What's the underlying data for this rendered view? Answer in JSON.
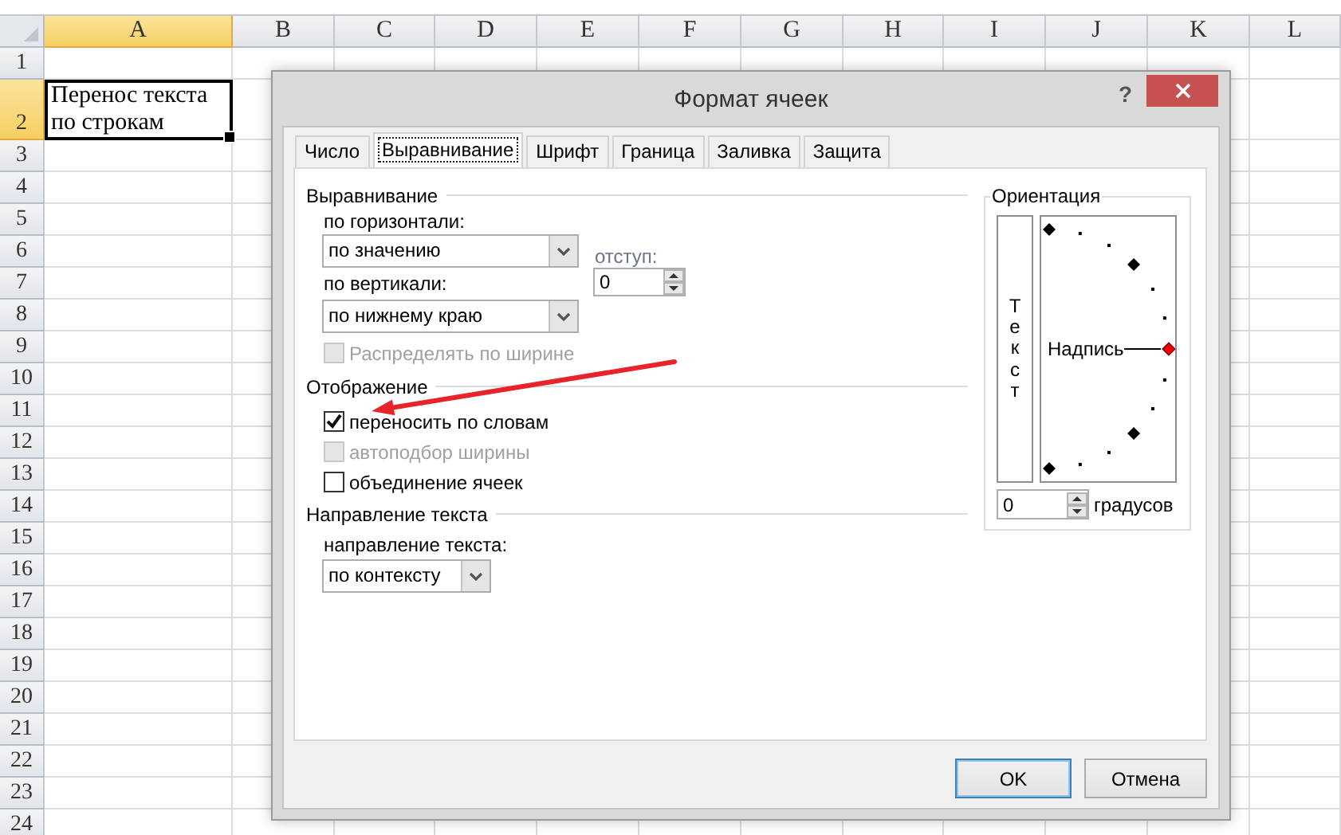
{
  "spreadsheet": {
    "columns": [
      {
        "label": "A",
        "selected": true
      },
      {
        "label": "B",
        "selected": false
      },
      {
        "label": "C",
        "selected": false
      },
      {
        "label": "D",
        "selected": false
      },
      {
        "label": "E",
        "selected": false
      },
      {
        "label": "F",
        "selected": false
      },
      {
        "label": "G",
        "selected": false
      },
      {
        "label": "H",
        "selected": false
      },
      {
        "label": "I",
        "selected": false
      },
      {
        "label": "J",
        "selected": false
      },
      {
        "label": "K",
        "selected": false
      },
      {
        "label": "L",
        "selected": false
      }
    ],
    "rows": [
      {
        "label": "1",
        "selected": false
      },
      {
        "label": "2",
        "selected": true,
        "cells": [
          {
            "text": "Перенос текста по строкам",
            "active": true
          }
        ]
      },
      {
        "label": "3",
        "selected": false
      },
      {
        "label": "4",
        "selected": false
      },
      {
        "label": "5",
        "selected": false
      },
      {
        "label": "6",
        "selected": false
      },
      {
        "label": "7",
        "selected": false
      },
      {
        "label": "8",
        "selected": false
      },
      {
        "label": "9",
        "selected": false
      },
      {
        "label": "10",
        "selected": false
      },
      {
        "label": "11",
        "selected": false
      },
      {
        "label": "12",
        "selected": false
      },
      {
        "label": "13",
        "selected": false
      },
      {
        "label": "14",
        "selected": false
      },
      {
        "label": "15",
        "selected": false
      },
      {
        "label": "16",
        "selected": false
      },
      {
        "label": "17",
        "selected": false
      },
      {
        "label": "18",
        "selected": false
      },
      {
        "label": "19",
        "selected": false
      },
      {
        "label": "20",
        "selected": false
      },
      {
        "label": "21",
        "selected": false
      },
      {
        "label": "22",
        "selected": false
      },
      {
        "label": "23",
        "selected": false
      },
      {
        "label": "24",
        "selected": false
      }
    ]
  },
  "dialog": {
    "title": "Формат ячеек",
    "help": "?",
    "tabs": [
      {
        "label": "Число",
        "selected": false
      },
      {
        "label": "Выравнивание",
        "selected": true
      },
      {
        "label": "Шрифт",
        "selected": false
      },
      {
        "label": "Граница",
        "selected": false
      },
      {
        "label": "Заливка",
        "selected": false
      },
      {
        "label": "Защита",
        "selected": false
      }
    ],
    "alignment": {
      "title": "Выравнивание",
      "horizontal": {
        "label": "по горизонтали:",
        "value": "по значению"
      },
      "indent": {
        "label": "отступ:",
        "value": "0"
      },
      "vertical": {
        "label": "по вертикали:",
        "value": "по нижнему краю"
      },
      "distributed": {
        "label": "Распределять по ширине",
        "checked": false,
        "disabled": true
      }
    },
    "display": {
      "title": "Отображение",
      "options": [
        {
          "label": "переносить по словам",
          "checked": true,
          "disabled": false
        },
        {
          "label": "автоподбор ширины",
          "checked": false,
          "disabled": true
        },
        {
          "label": "объединение ячеек",
          "checked": false,
          "disabled": false
        }
      ]
    },
    "direction": {
      "title": "Направление текста",
      "label": "направление текста:",
      "value": "по контексту"
    },
    "orientation": {
      "title": "Ориентация",
      "vertical_text": "Текст",
      "dial_label": "Надпись",
      "degrees": {
        "value": "0",
        "label": "градусов"
      }
    },
    "buttons": [
      {
        "label": "OK",
        "default": true
      },
      {
        "label": "Отмена",
        "default": false
      }
    ]
  },
  "annotation": {
    "kind": "arrow"
  }
}
